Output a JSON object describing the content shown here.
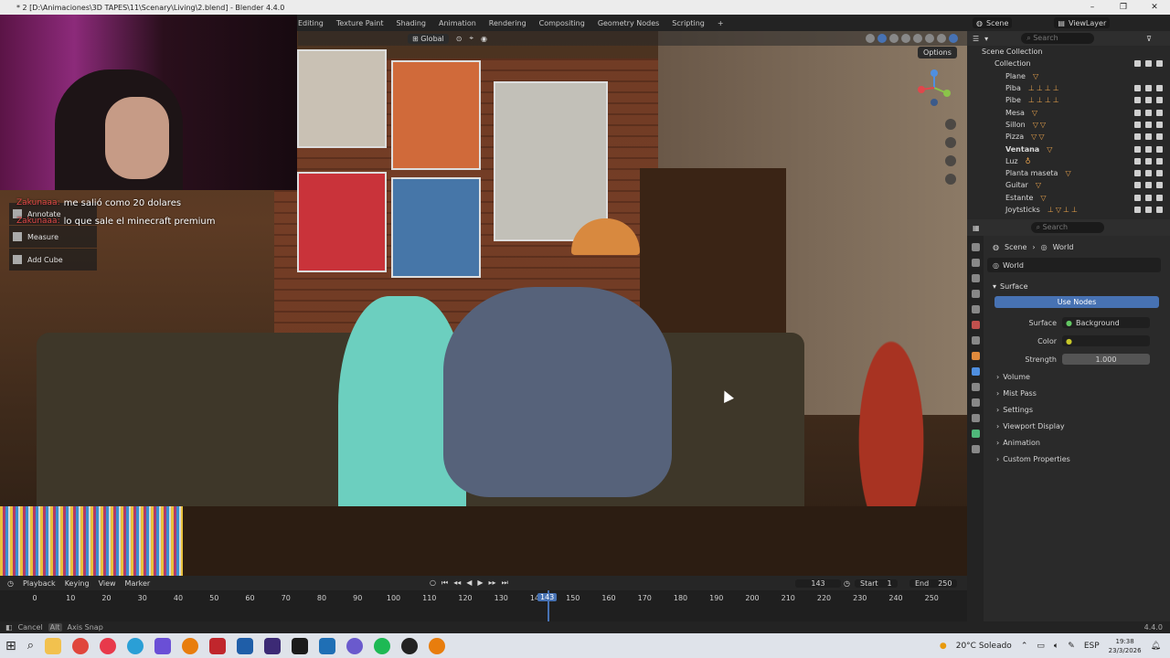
{
  "window": {
    "title": "* 2 [D:\\Animaciones\\3D TAPES\\11\\Scenary\\Living\\2.blend] - Blender 4.4.0"
  },
  "workspace_tabs": [
    "Editing",
    "Texture Paint",
    "Shading",
    "Animation",
    "Rendering",
    "Compositing",
    "Geometry Nodes",
    "Scripting"
  ],
  "scene": {
    "name": "Scene",
    "view_layer": "ViewLayer"
  },
  "viewport": {
    "transform_orientation": "Global",
    "options_label": "Options"
  },
  "chat": [
    {
      "user": "Zakunaaa:",
      "message": "me salió como 20 dolares"
    },
    {
      "user": "Zakunaaa:",
      "message": "lo que sale el minecraft premium"
    }
  ],
  "tools": [
    {
      "label": "Annotate",
      "icon": "annotate-icon"
    },
    {
      "label": "Measure",
      "icon": "measure-icon"
    },
    {
      "label": "Add Cube",
      "icon": "add-cube-icon"
    }
  ],
  "outliner": {
    "search_placeholder": "Search",
    "root": "Scene Collection",
    "collection": "Collection",
    "items": [
      "Plane",
      "Piba",
      "Pibe",
      "Mesa",
      "Sillon",
      "Pizza",
      "Ventana",
      "Luz",
      "Planta maseta",
      "Guitar",
      "Estante",
      "Joytsticks"
    ]
  },
  "properties": {
    "search_placeholder": "Search",
    "breadcrumb": [
      "Scene",
      "World"
    ],
    "world_name": "World",
    "surface_panel": "Surface",
    "use_nodes": "Use Nodes",
    "surface_label": "Surface",
    "surface_value": "Background",
    "color_label": "Color",
    "strength_label": "Strength",
    "strength_value": "1.000",
    "panels": [
      "Volume",
      "Mist Pass",
      "Settings",
      "Viewport Display",
      "Animation",
      "Custom Properties"
    ]
  },
  "timeline": {
    "menus": [
      "Playback",
      "Keying",
      "View",
      "Marker"
    ],
    "current_frame": "143",
    "start_label": "Start",
    "start_value": "1",
    "end_label": "End",
    "end_value": "250",
    "ticks": [
      "0",
      "10",
      "20",
      "30",
      "40",
      "50",
      "60",
      "70",
      "80",
      "90",
      "100",
      "110",
      "120",
      "130",
      "140",
      "150",
      "160",
      "170",
      "180",
      "190",
      "200",
      "210",
      "220",
      "230",
      "240",
      "250"
    ],
    "playhead_label": "143"
  },
  "statusbar": {
    "cancel": "Cancel",
    "alt": "Alt",
    "axis_snap": "Axis Snap",
    "version": "4.4.0"
  },
  "taskbar": {
    "weather": "20°C  Soleado",
    "language": "ESP",
    "time": "19:38",
    "date": "23/3/2026"
  },
  "colors": {
    "accent": "#4772b3",
    "chat_user": "#e34a4a"
  }
}
